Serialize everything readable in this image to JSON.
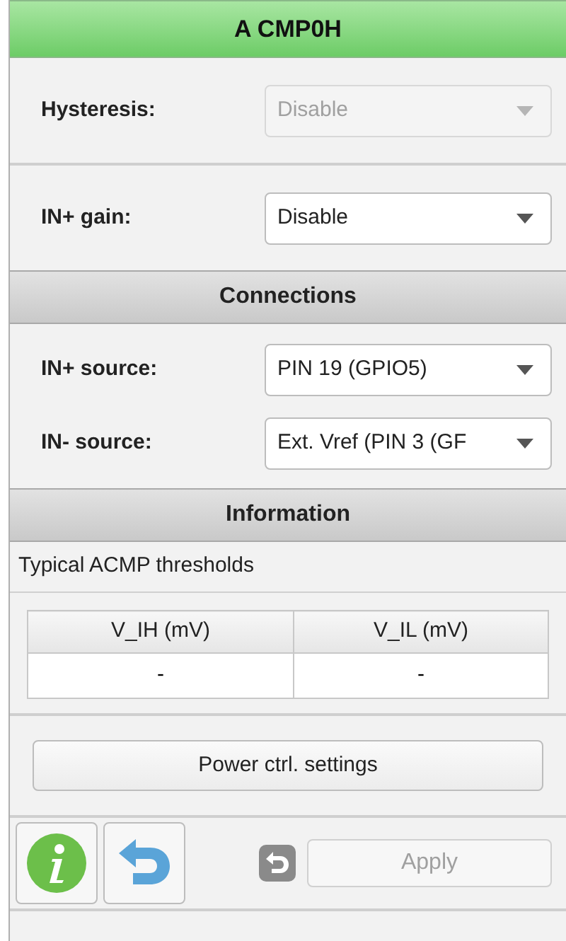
{
  "title": "A CMP0H",
  "settings": [
    {
      "label": "Hysteresis:",
      "value": "Disable",
      "disabled": true
    },
    {
      "label": "IN+ gain:",
      "value": "Disable",
      "disabled": false
    }
  ],
  "connections": {
    "header": "Connections",
    "rows": [
      {
        "label": "IN+ source:",
        "value": "PIN 19 (GPIO5)",
        "disabled": false
      },
      {
        "label": "IN- source:",
        "value": "Ext. Vref (PIN 3 (GF",
        "disabled": false
      }
    ]
  },
  "information": {
    "header": "Information",
    "caption": "Typical ACMP thresholds",
    "columns": [
      "V_IH (mV)",
      "V_IL (mV)"
    ],
    "rows": [
      [
        "-",
        "-"
      ]
    ]
  },
  "power_button": "Power ctrl. settings",
  "toolbar": {
    "apply": {
      "label": "Apply",
      "disabled": true
    }
  }
}
